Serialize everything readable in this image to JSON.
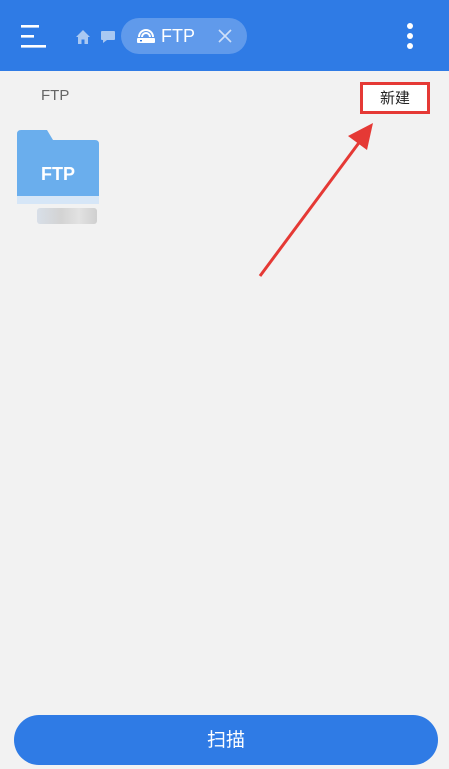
{
  "topbar": {
    "menu_icon": "hamburger-menu-icon",
    "home_icon": "home-icon",
    "storage_icon": "storage-icon",
    "tab": {
      "icon": "ftp-network-icon",
      "label": "FTP",
      "close_icon": "close-icon"
    },
    "more_icon": "more-vert-icon"
  },
  "path": {
    "label": "FTP"
  },
  "toolbar": {
    "new_label": "新建"
  },
  "items": [
    {
      "icon_text": "FTP",
      "name": ""
    }
  ],
  "bottom": {
    "scan_label": "扫描"
  },
  "colors": {
    "primary": "#2f7be5",
    "background": "#f2f2f2",
    "folder": "#6aaeed",
    "annotation": "#e53935"
  }
}
